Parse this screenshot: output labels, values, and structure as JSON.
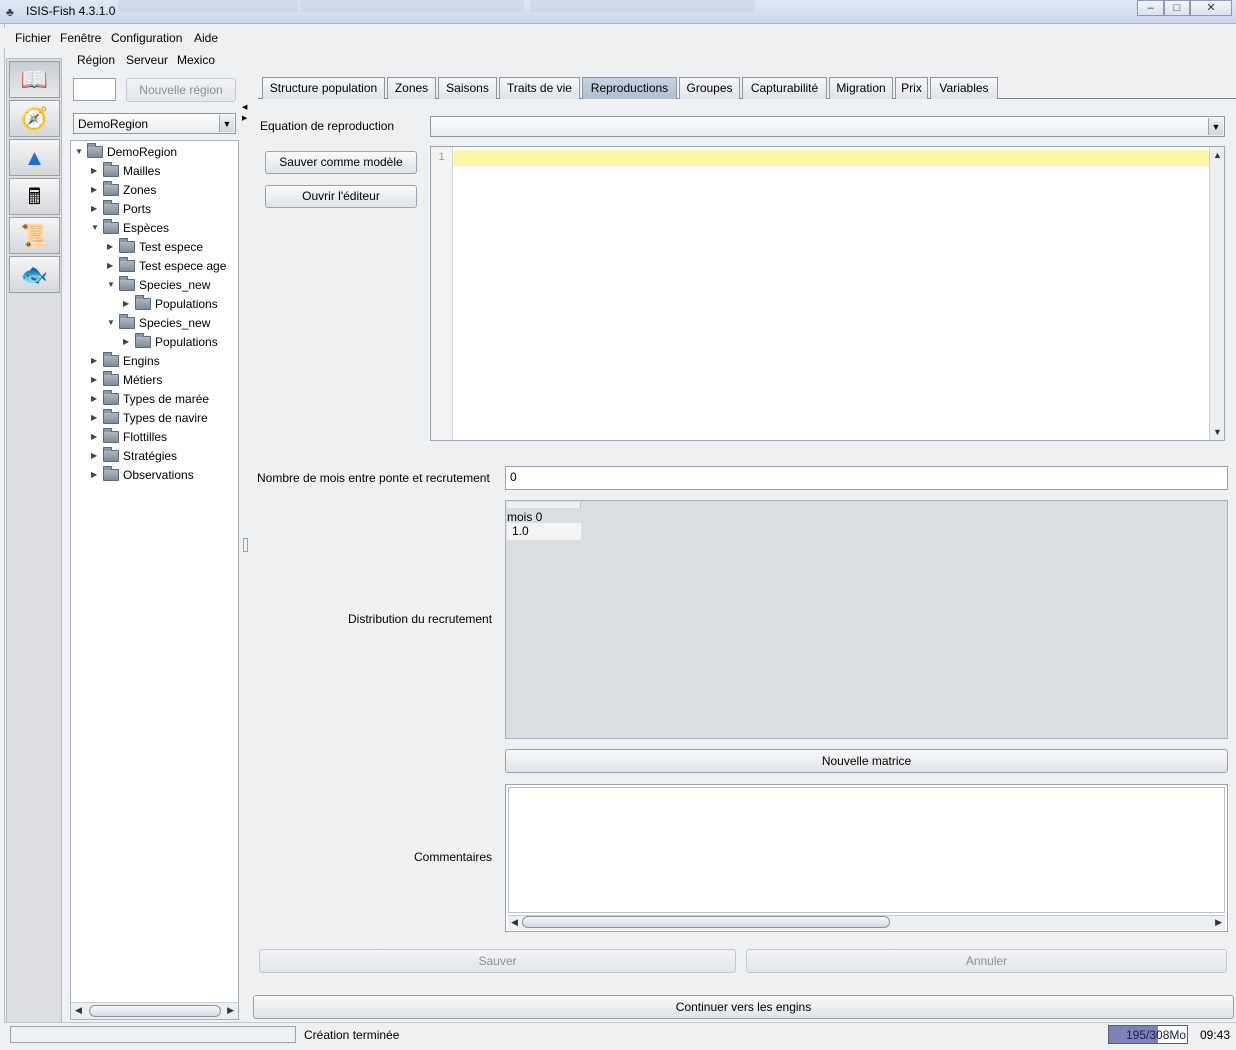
{
  "window": {
    "title": "ISIS-Fish 4.3.1.0",
    "controls": {
      "minimize": "‒",
      "maximize": "□",
      "close": "✕"
    }
  },
  "menubar": [
    "Fichier",
    "Fenêtre",
    "Configuration",
    "Aide"
  ],
  "toolicons": [
    "book-icon",
    "compass-icon",
    "3d-surface-icon",
    "calculator-icon",
    "notes-icon",
    "fish-icon"
  ],
  "region_panel": {
    "menu": [
      "Région",
      "Serveur",
      "Mexico"
    ],
    "new_region_button": "Nouvelle région",
    "selected_region": "DemoRegion",
    "tree": [
      {
        "label": "DemoRegion",
        "expanded": true
      },
      {
        "label": "Mailles",
        "expanded": false
      },
      {
        "label": "Zones",
        "expanded": false
      },
      {
        "label": "Ports",
        "expanded": false
      },
      {
        "label": "Espèces",
        "expanded": true
      },
      {
        "label": "Test espece",
        "expanded": false
      },
      {
        "label": "Test espece age",
        "expanded": false
      },
      {
        "label": "Species_new",
        "expanded": true
      },
      {
        "label": "Populations",
        "expanded": false
      },
      {
        "label": "Species_new",
        "expanded": true
      },
      {
        "label": "Populations",
        "expanded": false
      },
      {
        "label": "Engins",
        "expanded": false
      },
      {
        "label": "Métiers",
        "expanded": false
      },
      {
        "label": "Types de marée",
        "expanded": false
      },
      {
        "label": "Types de navire",
        "expanded": false
      },
      {
        "label": "Flottilles",
        "expanded": false
      },
      {
        "label": "Stratégies",
        "expanded": false
      },
      {
        "label": "Observations",
        "expanded": false
      }
    ]
  },
  "tabs": [
    {
      "label": "Structure population",
      "active": false
    },
    {
      "label": "Zones",
      "active": false
    },
    {
      "label": "Saisons",
      "active": false
    },
    {
      "label": "Traits de vie",
      "active": false
    },
    {
      "label": "Reproductions",
      "active": true
    },
    {
      "label": "Groupes",
      "active": false
    },
    {
      "label": "Capturabilité",
      "active": false
    },
    {
      "label": "Migration",
      "active": false
    },
    {
      "label": "Prix",
      "active": false
    },
    {
      "label": "Variables",
      "active": false
    }
  ],
  "reproduction": {
    "equation_label": "Equation de reproduction",
    "equation_value": "",
    "save_template_button": "Sauver comme modèle",
    "open_editor_button": "Ouvrir l'éditeur",
    "editor_line_number": "1",
    "months_label": "Nombre de mois entre ponte et recrutement",
    "months_value": "0",
    "distribution_label": "Distribution du recrutement",
    "matrix_column": "mois 0",
    "matrix_value": "1.0",
    "new_matrix_button": "Nouvelle matrice",
    "comments_label": "Commentaires",
    "comments_value": "",
    "save_button": "Sauver",
    "cancel_button": "Annuler",
    "continue_button": "Continuer vers les engins"
  },
  "statusbar": {
    "message": "Création terminée",
    "memory": "195/308Mo",
    "memory_fraction": 0.63,
    "time": "09:43"
  },
  "colors": {
    "active_tab": "#aebdd0",
    "editor_current_line": "#fbf6a8",
    "memory_fill": "#7c82b8"
  }
}
